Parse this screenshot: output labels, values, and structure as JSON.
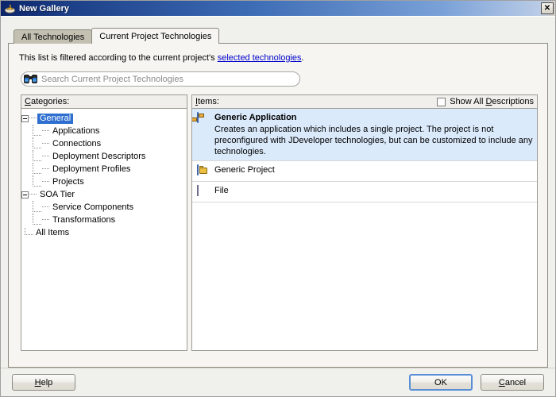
{
  "window": {
    "title": "New Gallery",
    "icon": "gallery-icon",
    "close_label": "✕"
  },
  "tabs": [
    {
      "label": "All Technologies",
      "active": false
    },
    {
      "label": "Current Project Technologies",
      "active": true
    }
  ],
  "filter_notice": {
    "prefix": "This list is filtered according to the current project's ",
    "link": "selected technologies",
    "suffix": "."
  },
  "search": {
    "icon": "binoculars-icon",
    "placeholder": "Search Current Project Technologies",
    "value": ""
  },
  "categories_pane": {
    "header_prefix": "C",
    "header_rest": "ategories:",
    "tree": [
      {
        "label": "General",
        "level": 0,
        "expander": "minus",
        "selected": true
      },
      {
        "label": "Applications",
        "level": 1,
        "expander": "none",
        "selected": false
      },
      {
        "label": "Connections",
        "level": 1,
        "expander": "none",
        "selected": false
      },
      {
        "label": "Deployment Descriptors",
        "level": 1,
        "expander": "none",
        "selected": false
      },
      {
        "label": "Deployment Profiles",
        "level": 1,
        "expander": "none",
        "selected": false
      },
      {
        "label": "Projects",
        "level": 1,
        "expander": "none",
        "selected": false
      },
      {
        "label": "SOA Tier",
        "level": 0,
        "expander": "minus",
        "selected": false
      },
      {
        "label": "Service Components",
        "level": 1,
        "expander": "none",
        "selected": false
      },
      {
        "label": "Transformations",
        "level": 1,
        "expander": "none",
        "selected": false
      },
      {
        "label": "All Items",
        "level": 0,
        "expander": "none",
        "selected": false
      }
    ]
  },
  "items_pane": {
    "header_prefix": "I",
    "header_rest": "tems:",
    "show_all_descriptions": {
      "checked": false,
      "label_pre": "Show All ",
      "label_key": "D",
      "label_post": "escriptions"
    },
    "items": [
      {
        "title": "Generic Application",
        "description": "Creates an application which includes a single project. The project is not preconfigured with JDeveloper technologies, but can be customized to include any technologies.",
        "icon": "application-icon",
        "selected": true
      },
      {
        "title": "Generic Project",
        "description": "",
        "icon": "folder-icon",
        "selected": false
      },
      {
        "title": "File",
        "description": "",
        "icon": "file-icon",
        "selected": false
      }
    ]
  },
  "footer": {
    "help": {
      "pre": "",
      "key": "H",
      "post": "elp"
    },
    "ok": {
      "pre": "OK",
      "key": "",
      "post": ""
    },
    "cancel": {
      "pre": "",
      "key": "C",
      "post": "ancel"
    }
  },
  "colors": {
    "title_start": "#0b246a",
    "title_end": "#b9cbe6",
    "selection_blue": "#2f6fd0",
    "item_selected_bg": "#dbeafb",
    "link": "#0000cc",
    "dialog_bg": "#f0f0ec"
  }
}
